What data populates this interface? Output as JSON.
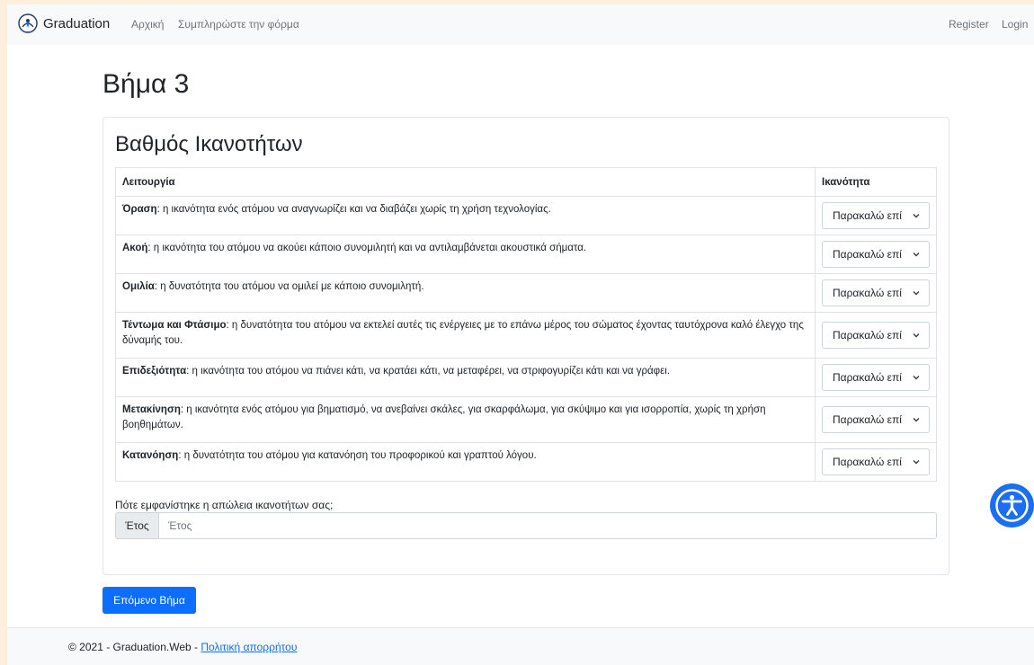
{
  "navbar": {
    "brand": "Graduation",
    "links": [
      "Αρχική",
      "Συμπληρώστε την φόρμα"
    ],
    "register": "Register",
    "login": "Login"
  },
  "step_title": "Βήμα 3",
  "card": {
    "title": "Βαθμός Ικανοτήτων",
    "columns": [
      "Λειτουργία",
      "Ικανότητα"
    ],
    "rows": [
      {
        "name": "Όραση",
        "desc": ": η ικανότητα ενός ατόμου να αναγνωρίζει και να διαβάζει χωρίς τη χρήση τεχνολογίας.",
        "select": "Παρακαλώ επί"
      },
      {
        "name": "Ακοή",
        "desc": ": η ικανότητα του ατόμου να ακούει κάποιο συνομιλητή και να αντιλαμβάνεται ακουστικά σήματα.",
        "select": "Παρακαλώ επί"
      },
      {
        "name": "Ομιλία",
        "desc": ": η δυνατότητα του ατόμου να ομιλεί με κάποιο συνομιλητή.",
        "select": "Παρακαλώ επί"
      },
      {
        "name": "Τέντωμα και Φτάσιμο",
        "desc": ": η δυνατότητα του ατόμου να εκτελεί αυτές τις ενέργειες με το επάνω μέρος του σώματος έχοντας ταυτόχρονα καλό έλεγχο της δύναμής του.",
        "select": "Παρακαλώ επί"
      },
      {
        "name": "Επιδεξιότητα",
        "desc": ": η ικανότητα του ατόμου να πιάνει κάτι, να κρατάει κάτι, να μεταφέρει, να στριφογυρίζει κάτι και να γράφει.",
        "select": "Παρακαλώ επί"
      },
      {
        "name": "Μετακίνηση",
        "desc": ": η ικανότητα ενός ατόμου για βηματισμό, να ανεβαίνει σκάλες, για σκαρφάλωμα, για σκύψιμο και για ισορροπία, χωρίς τη χρήση βοηθημάτων.",
        "select": "Παρακαλώ επί"
      },
      {
        "name": "Κατανόηση",
        "desc": ": η δυνατότητα του ατόμου για κατανόηση του προφορικού και γραπτού λόγου.",
        "select": "Παρακαλώ επί"
      }
    ],
    "question": "Πότε εμφανίστηκε η απώλεια ικανοτήτων σας;",
    "year_addon": "Έτος",
    "year_placeholder": "Έτος",
    "year_value": ""
  },
  "next_button": "Επόμενο Βήμα",
  "footer": {
    "copyright": "© 2021 - Graduation.Web - ",
    "privacy": "Πολιτική απορρήτου"
  },
  "icons": {
    "logo": "graduation-logo-icon",
    "select_chevron": "chevron-down-icon",
    "accessibility": "accessibility-icon"
  },
  "colors": {
    "primary": "#0d6efd",
    "accessibility": "#1b6ef3",
    "page_border": "#fdeede"
  }
}
